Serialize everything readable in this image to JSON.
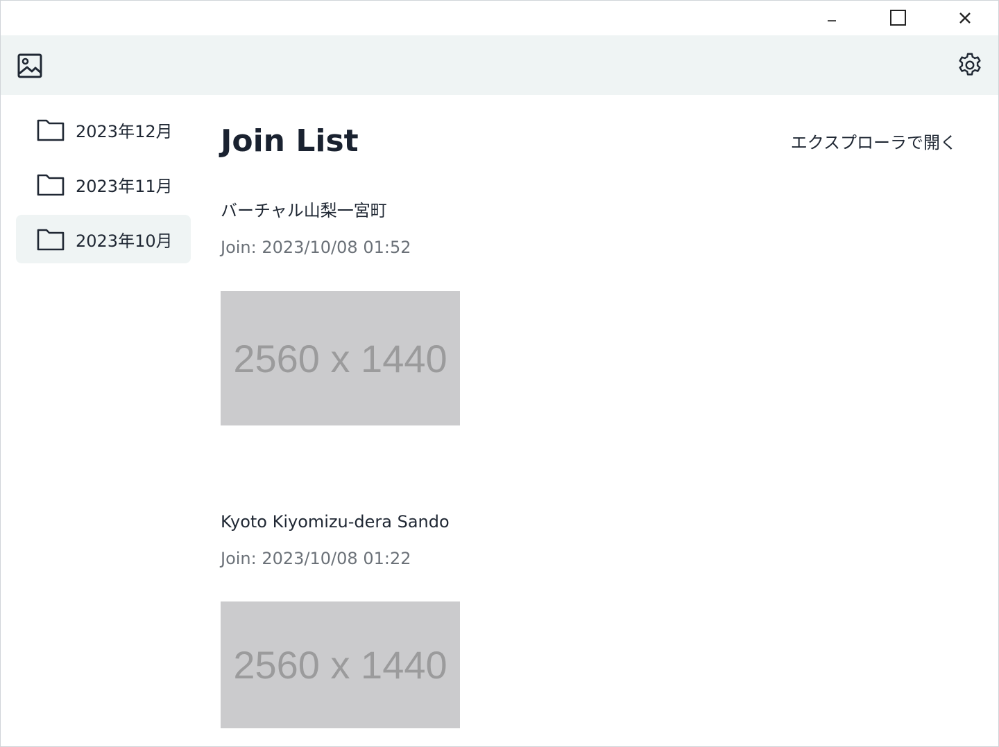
{
  "window_controls": {
    "minimize_icon": "minimize-icon",
    "maximize_icon": "maximize-icon",
    "close_icon": "close-icon"
  },
  "header": {
    "logo_icon": "image-icon",
    "settings_icon": "gear-icon"
  },
  "sidebar": {
    "items": [
      {
        "label": "2023年12月",
        "icon": "folder-icon",
        "selected": false
      },
      {
        "label": "2023年11月",
        "icon": "folder-icon",
        "selected": false
      },
      {
        "label": "2023年10月",
        "icon": "folder-icon",
        "selected": true
      }
    ]
  },
  "main": {
    "title": "Join List",
    "open_explorer_label": "エクスプローラで開く",
    "entries": [
      {
        "name": "バーチャル山梨一宮町",
        "join_time": "Join: 2023/10/08 01:52",
        "thumbnail_text": "2560 x 1440"
      },
      {
        "name": "Kyoto Kiyomizu-dera Sando",
        "join_time": "Join: 2023/10/08 01:22",
        "thumbnail_text": "2560 x 1440"
      }
    ]
  },
  "colors": {
    "header_bg": "#eff4f4",
    "selected_bg": "#eff4f4",
    "text": "#1f2733",
    "muted_text": "#6b7178",
    "thumbnail_bg": "#cbcbcd"
  }
}
